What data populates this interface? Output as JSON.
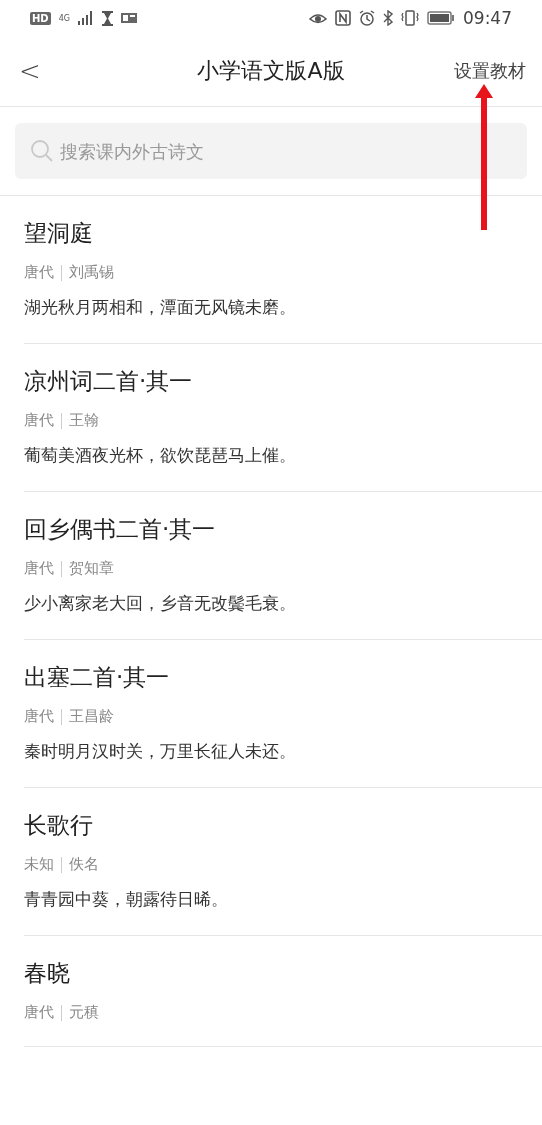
{
  "status_bar": {
    "hd": "HD",
    "network": "4G",
    "time": "09:47"
  },
  "header": {
    "back": "<",
    "title": "小学语文版A版",
    "action": "设置教材"
  },
  "search": {
    "placeholder": "搜索课内外古诗文"
  },
  "poems": [
    {
      "title": "望洞庭",
      "dynasty": "唐代",
      "author": "刘禹锡",
      "line": "湖光秋月两相和，潭面无风镜未磨。"
    },
    {
      "title": "凉州词二首·其一",
      "dynasty": "唐代",
      "author": "王翰",
      "line": "葡萄美酒夜光杯，欲饮琵琶马上催。"
    },
    {
      "title": "回乡偶书二首·其一",
      "dynasty": "唐代",
      "author": "贺知章",
      "line": "少小离家老大回，乡音无改鬓毛衰。"
    },
    {
      "title": "出塞二首·其一",
      "dynasty": "唐代",
      "author": "王昌龄",
      "line": "秦时明月汉时关，万里长征人未还。"
    },
    {
      "title": "长歌行",
      "dynasty": "未知",
      "author": "佚名",
      "line": "青青园中葵，朝露待日晞。"
    },
    {
      "title": "春晓",
      "dynasty": "唐代",
      "author": "元稹"
    }
  ]
}
